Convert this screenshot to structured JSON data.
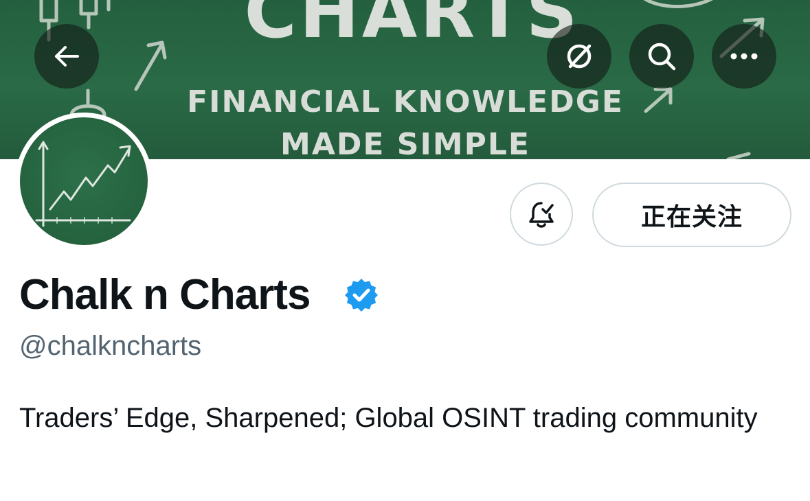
{
  "banner": {
    "title": "CHARTS",
    "subtitle_line1": "FINANCIAL KNOWLEDGE",
    "subtitle_line2": "MADE SIMPLE"
  },
  "top_bar": {
    "back_icon": "arrow-left-icon",
    "translate_icon": "slashed-circle-icon",
    "search_icon": "search-icon",
    "more_icon": "more-horizontal-icon"
  },
  "actions": {
    "notify_icon": "bell-check-icon",
    "follow_label": "正在关注"
  },
  "profile": {
    "display_name": "Chalk n Charts",
    "verified_icon": "verified-badge-icon",
    "handle": "@chalkncharts",
    "bio": "Traders’ Edge, Sharpened; Global OSINT trading community"
  },
  "colors": {
    "banner_green": "#2a6a46",
    "verified_blue": "#1d9bf0",
    "text_primary": "#0f1419",
    "text_secondary": "#536471",
    "border": "#cfd9de"
  }
}
